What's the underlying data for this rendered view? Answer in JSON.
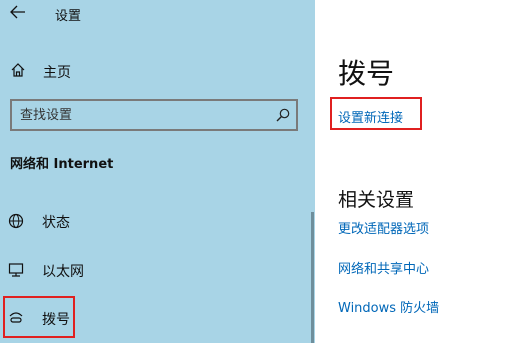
{
  "window": {
    "title": "设置"
  },
  "sidebar": {
    "home_label": "主页",
    "search_placeholder": "查找设置",
    "section_title": "网络和 Internet",
    "items": [
      {
        "label": "状态",
        "icon": "globe-icon"
      },
      {
        "label": "以太网",
        "icon": "ethernet-icon"
      },
      {
        "label": "拨号",
        "icon": "dialup-icon",
        "selected": true
      }
    ]
  },
  "main": {
    "title": "拨号",
    "new_connection_link": "设置新连接",
    "related_heading": "相关设置",
    "related_links": [
      "更改适配器选项",
      "网络和共享中心",
      "Windows 防火墙"
    ]
  },
  "colors": {
    "sidebar_bg": "#a8d4e6",
    "link": "#0067b8",
    "highlight": "#e02020"
  }
}
